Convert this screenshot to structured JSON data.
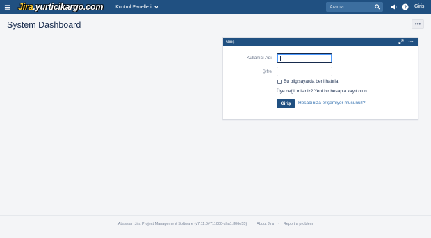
{
  "header": {
    "logo_prefix": "Jira",
    "logo_main": ".yurticikargo.com",
    "nav_dashboards": "Kontrol Panelleri",
    "search_placeholder": "Arama",
    "login_link": "Giriş"
  },
  "page": {
    "title": "System Dashboard",
    "more_label": "•••"
  },
  "gadget": {
    "title": "Giriş",
    "username_label_underlined": "K",
    "username_label_rest": "ullanıcı Adı",
    "password_label_underlined": "Ş",
    "password_label_rest": "ifre",
    "remember_label": "Bu bilgisayarda beni hatırla",
    "signup_text": "Üye değil misiniz? Yeni bir hesapla kayıt olun.",
    "login_button": "Giriş",
    "forgot_link": "Hesabınıza erişemiyor musunuz?"
  },
  "footer": {
    "product": "Atlassian Jira Project Management Software",
    "version": "(v7.11.0#711000-sha1:ff06e55)",
    "sep": "·",
    "about": "About Jira",
    "report": "Report a problem"
  },
  "colors": {
    "header_bg": "#205081",
    "page_bg": "#f4f5f7",
    "link": "#3572b0"
  },
  "icons": [
    "menu-icon",
    "chevron-down-icon",
    "search-icon",
    "megaphone-icon",
    "help-icon",
    "expand-icon",
    "ellipsis-icon"
  ]
}
